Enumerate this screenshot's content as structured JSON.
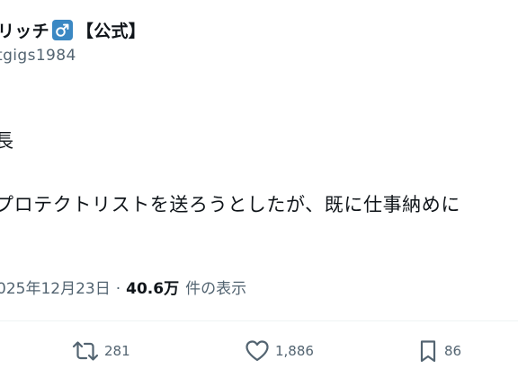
{
  "author": {
    "name_before_badge": "リッチ",
    "badge_icon": "male-sign-icon",
    "name_after_badge": "【公式】",
    "handle": "tgigs1984"
  },
  "post": {
    "line1": "長",
    "line2": "プロテクトリストを送ろうとしたが、既に仕事納めに",
    "date": "025年12月23日",
    "separator": "·",
    "views_count": "40.6万",
    "views_label": "件の表示"
  },
  "actions": {
    "retweet": {
      "icon": "retweet-icon",
      "count": "281"
    },
    "like": {
      "icon": "heart-icon",
      "count": "1,886"
    },
    "bookmark": {
      "icon": "bookmark-icon",
      "count": "86"
    }
  },
  "colors": {
    "text_primary": "#0f1419",
    "text_secondary": "#536471",
    "badge_blue": "#3b88c3",
    "divider": "#eff3f4"
  }
}
